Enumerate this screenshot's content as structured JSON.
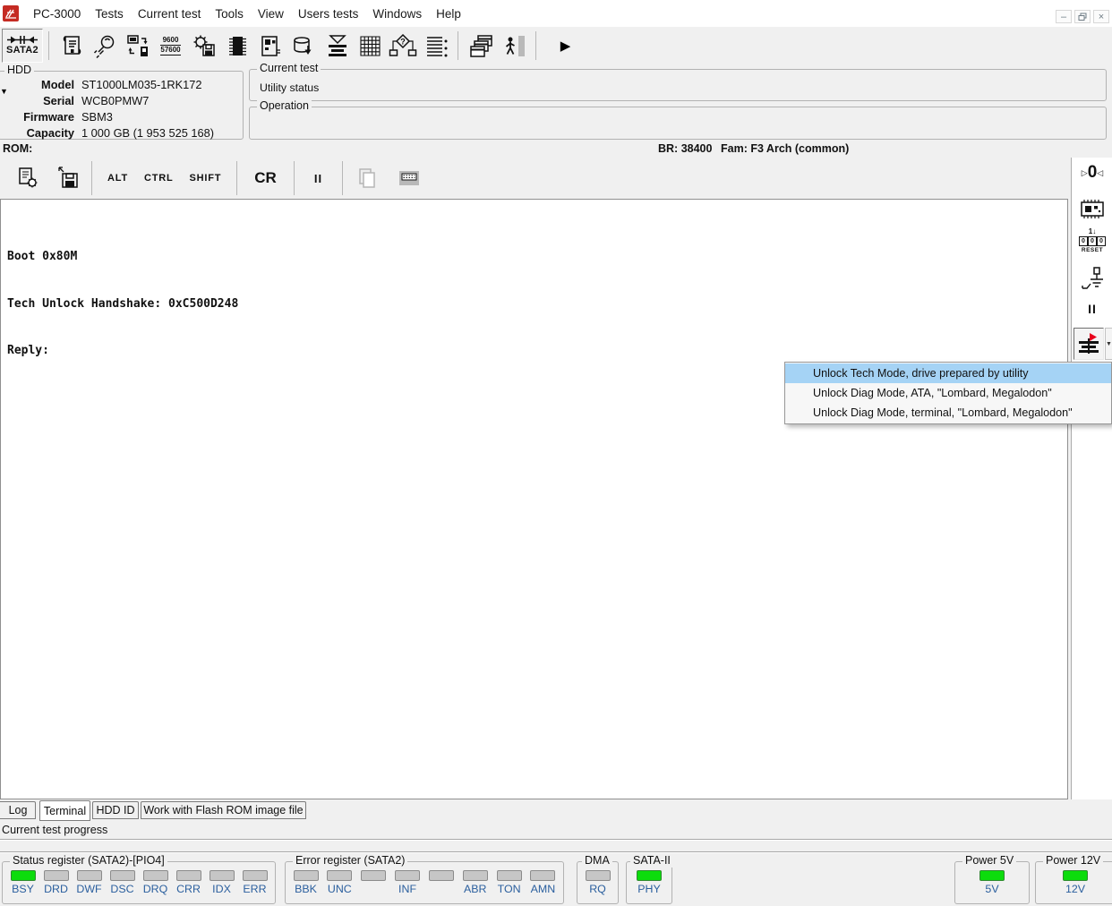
{
  "colors": {
    "menu_highlight": "#a5d3f5",
    "led_green": "#0cdc0c",
    "led_gray": "#c6c6c6",
    "label_blue": "#2b5f9e",
    "logo_red": "#c52b23",
    "flag_red": "#e8001c"
  },
  "menu_bar": {
    "items": [
      "PC-3000",
      "Tests",
      "Current test",
      "Tools",
      "View",
      "Users tests",
      "Windows",
      "Help"
    ],
    "minimize_glyph": "–",
    "close_glyph": "×"
  },
  "toolbar": {
    "sata_label": "SATA2",
    "baud_top": "9600",
    "baud_bottom": "57600",
    "play_glyph": "▶"
  },
  "hdd_panel": {
    "title": "HDD",
    "model_label": "Model",
    "model_value": "ST1000LM035-1RK172",
    "serial_label": "Serial",
    "serial_value": "WCB0PMW7",
    "firmware_label": "Firmware",
    "firmware_value": "SBM3",
    "capacity_label": "Capacity",
    "capacity_value": "1 000 GB (1 953 525 168)"
  },
  "current_test_panel": {
    "title": "Current test",
    "status": "Utility status"
  },
  "operation_panel": {
    "title": "Operation"
  },
  "rom_bar": {
    "rom": "ROM:",
    "baud": "BR: 38400",
    "family": "Fam: F3 Arch (common)"
  },
  "terminal_toolbar": {
    "alt": "ALT",
    "ctrl": "CTRL",
    "shift": "SHIFT",
    "cr": "CR",
    "pause": "II"
  },
  "terminal": {
    "line1": "Boot 0x80M",
    "line2": "Tech Unlock Handshake: 0xC500D248",
    "line3": "Reply:"
  },
  "side_toolbar": {
    "zero_left": "▷",
    "zero": "0",
    "zero_right": "◁",
    "reset_top": "1↓",
    "reset_digits": [
      "0",
      "0",
      "0"
    ],
    "reset_label": "RESET",
    "pause": "II",
    "dropdown_glyph": "▼"
  },
  "context_menu": {
    "items": [
      {
        "label": "Unlock Tech Mode, drive prepared by utility",
        "highlighted": true
      },
      {
        "label": "Unlock Diag Mode, ATA, \"Lombard, Megalodon\"",
        "highlighted": false
      },
      {
        "label": "Unlock Diag Mode, terminal, \"Lombard, Megalodon\"",
        "highlighted": false
      }
    ]
  },
  "tabs": {
    "log": "Log",
    "terminal": "Terminal",
    "hdd_id": "HDD ID",
    "flash": "Work with Flash ROM image file"
  },
  "progress": {
    "label": "Current test progress"
  },
  "status_bar": {
    "status_register": {
      "title": "Status register (SATA2)-[PIO4]",
      "leds": [
        {
          "label": "BSY",
          "on": true
        },
        {
          "label": "DRD",
          "on": false
        },
        {
          "label": "DWF",
          "on": false
        },
        {
          "label": "DSC",
          "on": false
        },
        {
          "label": "DRQ",
          "on": false
        },
        {
          "label": "CRR",
          "on": false
        },
        {
          "label": "IDX",
          "on": false
        },
        {
          "label": "ERR",
          "on": false
        }
      ]
    },
    "error_register": {
      "title": "Error register (SATA2)",
      "leds": [
        {
          "label": "BBK",
          "on": false
        },
        {
          "label": "UNC",
          "on": false
        },
        {
          "label": "",
          "on": false
        },
        {
          "label": "INF",
          "on": false
        },
        {
          "label": "",
          "on": false
        },
        {
          "label": "ABR",
          "on": false
        },
        {
          "label": "TON",
          "on": false
        },
        {
          "label": "AMN",
          "on": false
        }
      ]
    },
    "dma": {
      "title": "DMA",
      "led_label": "RQ",
      "on": false
    },
    "sata": {
      "title": "SATA-II",
      "led_label": "PHY",
      "on": true
    },
    "power5": {
      "title": "Power 5V",
      "led_label": "5V",
      "on": true
    },
    "power12": {
      "title": "Power 12V",
      "led_label": "12V",
      "on": true
    }
  }
}
